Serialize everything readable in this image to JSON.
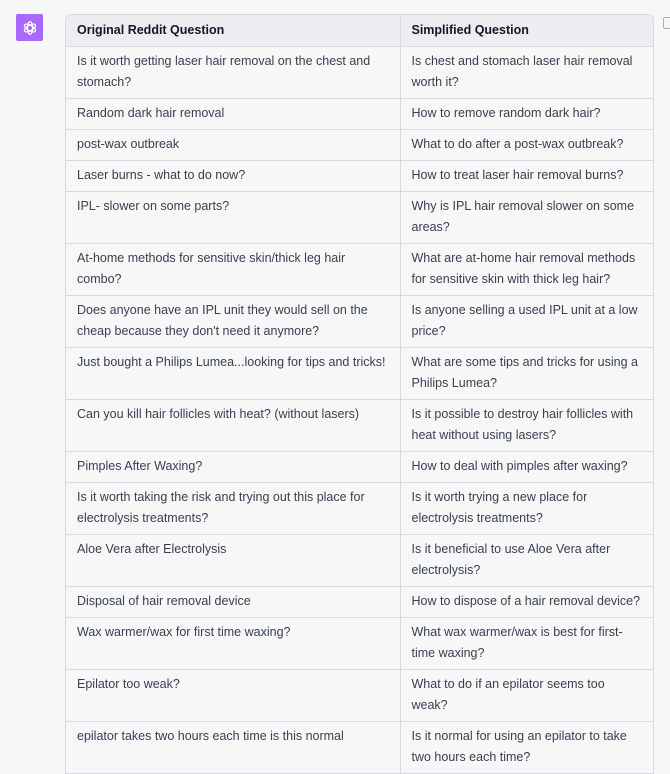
{
  "assistant": {
    "avatar_icon": "openai-logo-icon",
    "avatar_color": "#ab68ff",
    "copy_icon": "clipboard-icon"
  },
  "table": {
    "headers": [
      "Original Reddit Question",
      "Simplified Question"
    ],
    "rows": [
      [
        "Is it worth getting laser hair removal on the chest and stomach?",
        "Is chest and stomach laser hair removal worth it?"
      ],
      [
        "Random dark hair removal",
        "How to remove random dark hair?"
      ],
      [
        "post-wax outbreak",
        "What to do after a post-wax outbreak?"
      ],
      [
        "Laser burns - what to do now?",
        "How to treat laser hair removal burns?"
      ],
      [
        "IPL- slower on some parts?",
        "Why is IPL hair removal slower on some areas?"
      ],
      [
        "At-home methods for sensitive skin/thick leg hair combo?",
        "What are at-home hair removal methods for sensitive skin with thick leg hair?"
      ],
      [
        "Does anyone have an IPL unit they would sell on the cheap because they don't need it anymore?",
        "Is anyone selling a used IPL unit at a low price?"
      ],
      [
        "Just bought a Philips Lumea...looking for tips and tricks!",
        "What are some tips and tricks for using a Philips Lumea?"
      ],
      [
        "Can you kill hair follicles with heat? (without lasers)",
        "Is it possible to destroy hair follicles with heat without using lasers?"
      ],
      [
        "Pimples After Waxing?",
        "How to deal with pimples after waxing?"
      ],
      [
        "Is it worth taking the risk and trying out this place for electrolysis treatments?",
        "Is it worth trying a new place for electrolysis treatments?"
      ],
      [
        "Aloe Vera after Electrolysis",
        "Is it beneficial to use Aloe Vera after electrolysis?"
      ],
      [
        "Disposal of hair removal device",
        "How to dispose of a hair removal device?"
      ],
      [
        "Wax warmer/wax for first time waxing?",
        "What wax warmer/wax is best for first-time waxing?"
      ],
      [
        "Epilator too weak?",
        "What to do if an epilator seems too weak?"
      ],
      [
        "epilator takes two hours each time is this normal",
        "Is it normal for using an epilator to take two hours each time?"
      ]
    ]
  }
}
